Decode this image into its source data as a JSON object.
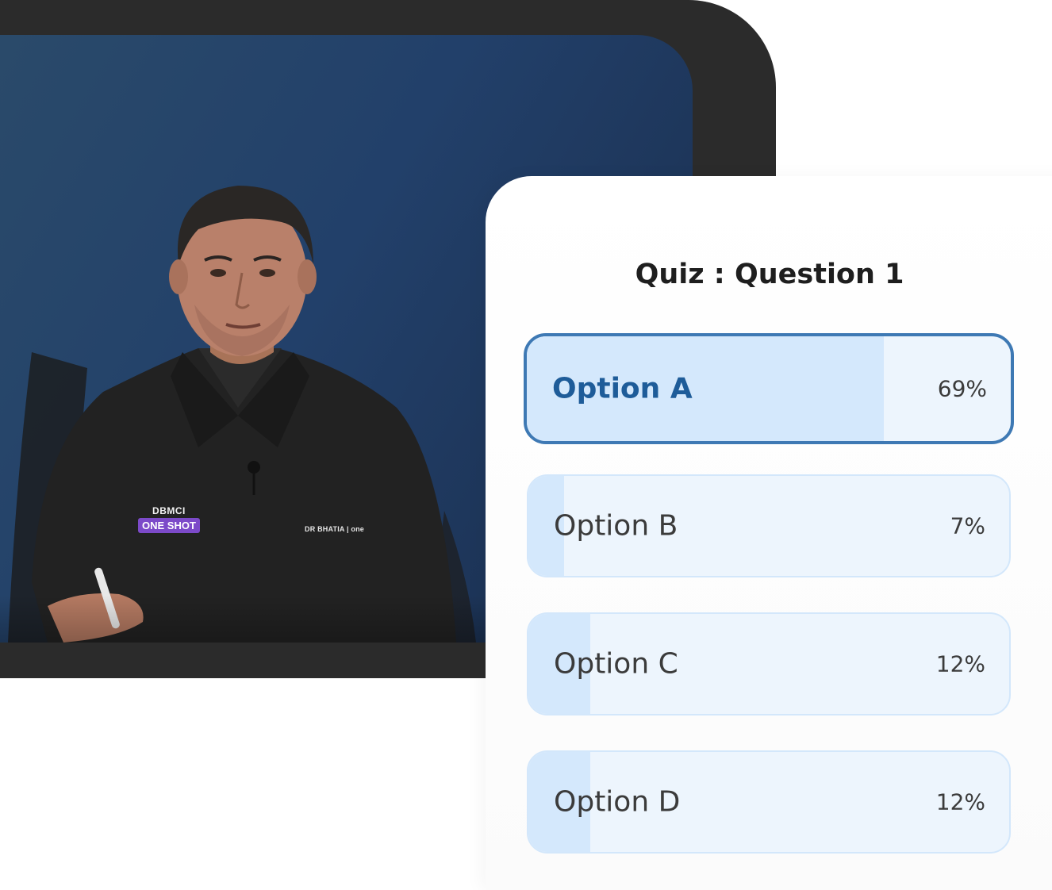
{
  "presenter": {
    "badge_top": "DBMCI",
    "badge_bottom": "ONE SHOT",
    "shirt_logo": "DR BHATIA | one",
    "badge_color": "#7c4ac9"
  },
  "quiz": {
    "title": "Quiz : Question 1",
    "accent_color": "#3e79b4",
    "options": [
      {
        "label": "Option A",
        "percent_text": "69%",
        "percent": 0.69,
        "selected": true
      },
      {
        "label": "Option B",
        "percent_text": "7%",
        "percent": 0.07,
        "selected": false
      },
      {
        "label": "Option C",
        "percent_text": "12%",
        "percent": 0.12,
        "selected": false
      },
      {
        "label": "Option D",
        "percent_text": "12%",
        "percent": 0.12,
        "selected": false
      }
    ]
  }
}
